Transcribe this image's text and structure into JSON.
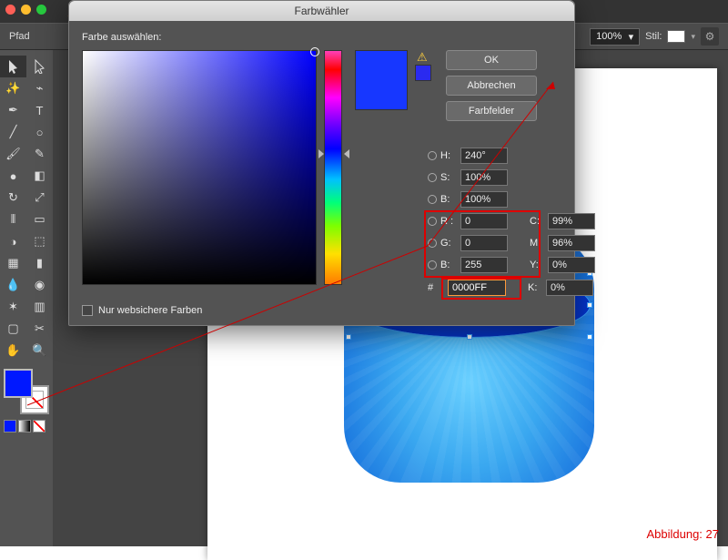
{
  "app": {
    "control_label": "Pfad",
    "zoom": "100%",
    "style_label": "Stil:"
  },
  "dialog": {
    "title": "Farbwähler",
    "prompt": "Farbe auswählen:",
    "buttons": {
      "ok": "OK",
      "cancel": "Abbrechen",
      "swatches": "Farbfelder"
    },
    "hsb": {
      "h_label": "H:",
      "h": "240°",
      "s_label": "S:",
      "s": "100%",
      "b_label": "B:",
      "b": "100%"
    },
    "rgb": {
      "r_label": "R :",
      "r": "0",
      "g_label": "G:",
      "g": "0",
      "b_label": "B:",
      "b": "255"
    },
    "cmyk": {
      "c_label": "C:",
      "c": "99%",
      "m_label": "M:",
      "m": "96%",
      "y_label": "Y:",
      "y": "0%",
      "k_label": "K:",
      "k": "0%"
    },
    "hex_label": "#",
    "hex": "0000FF",
    "websafe": "Nur websichere Farben"
  },
  "caption": "Abbildung: 27"
}
